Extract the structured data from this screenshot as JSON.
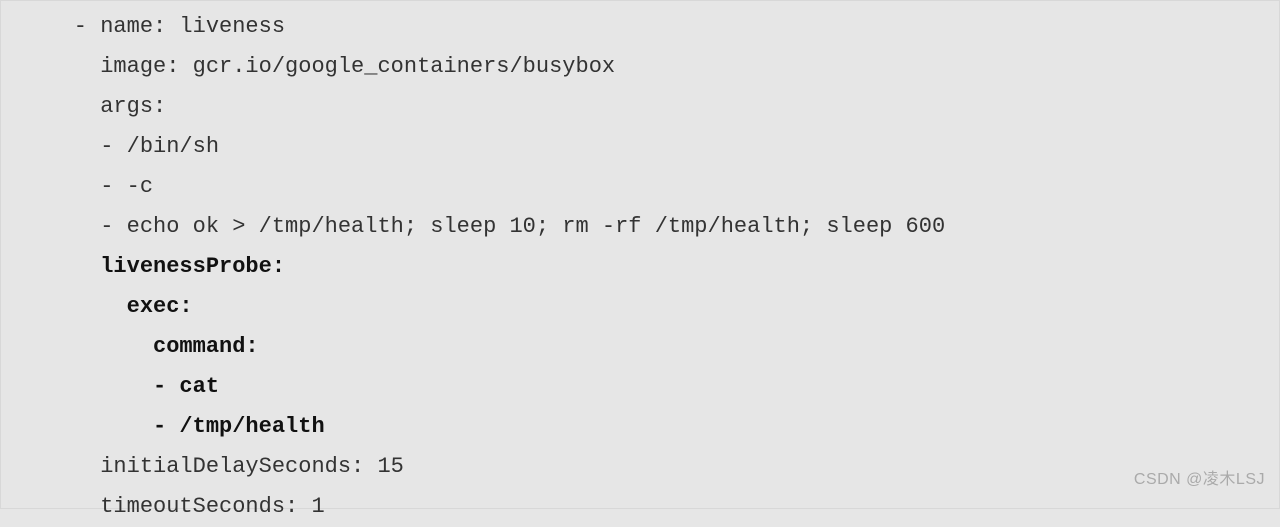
{
  "code": {
    "l1": "    - name: liveness",
    "l2": "      image: gcr.io/google_containers/busybox",
    "l3": "      args:",
    "l4": "      - /bin/sh",
    "l5": "      - -c",
    "l6": "      - echo ok > /tmp/health; sleep 10; rm -rf /tmp/health; sleep 600",
    "l7": "      livenessProbe:",
    "l8": "        exec:",
    "l9": "          command:",
    "l10": "          - cat",
    "l11": "          - /tmp/health",
    "l12": "      initialDelaySeconds: 15",
    "l13": "      timeoutSeconds: 1"
  },
  "watermark": "CSDN @凌木LSJ"
}
